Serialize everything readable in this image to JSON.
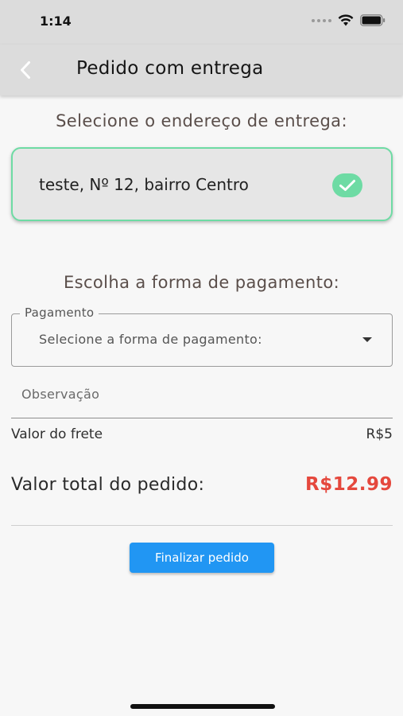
{
  "status_bar": {
    "time": "1:14"
  },
  "app_bar": {
    "title": "Pedido com entrega",
    "back_icon": "chevron-left-icon"
  },
  "address_section": {
    "title": "Selecione o endereço de entrega:",
    "selected_address": "teste, Nº 12, bairro Centro",
    "selected_icon": "check-icon",
    "accent_color": "#6edba4"
  },
  "payment_section": {
    "title": "Escolha a forma de pagamento:",
    "field_label": "Pagamento",
    "field_value": "Selecione a forma de pagamento:",
    "dropdown_icon": "arrow-drop-down-icon"
  },
  "observation": {
    "placeholder": "Observação",
    "value": ""
  },
  "summary": {
    "freight_label": "Valor do frete",
    "freight_value": "R$5",
    "total_label": "Valor total do pedido:",
    "total_value": "R$12.99",
    "total_color": "#e5483d"
  },
  "actions": {
    "finish_label": "Finalizar pedido",
    "finish_color": "#2196f3"
  }
}
